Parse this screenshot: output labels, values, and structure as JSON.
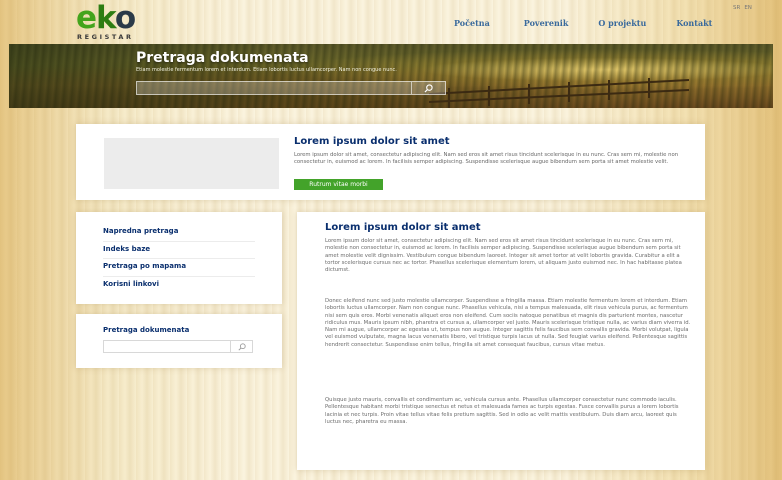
{
  "logo": {
    "word_e": "e",
    "word_k": "k",
    "word_o": "o",
    "subtitle": "REGISTAR",
    "colors": {
      "e": "#43a41c",
      "k": "#2d7d12",
      "o": "#2a3a48"
    }
  },
  "languages": [
    "SR",
    "EN"
  ],
  "nav": [
    "Početna",
    "Poverenik",
    "O projektu",
    "Kontakt"
  ],
  "banner": {
    "title": "Pretraga dokumenata",
    "text": "Etiam molestie fermentum lorem et interdum. Etiam lobortis luctus ullamcorper. Nam non congue nunc.",
    "search_value": "",
    "search_icon": "search-icon"
  },
  "featured": {
    "title": "Lorem ipsum dolor sit amet",
    "text": "Lorem ipsum dolor sit amet, consectetur adipiscing elit. Nam sed eros sit amet risus tincidunt scelerisque in eu nunc. Cras sem mi, molestie non consectetur in, euismod ac lorem. In facilisis semper adipiscing. Suspendisse scelerisque augue bibendum sem porta sit amet molestie velit.",
    "button": "Rutrum vitae morbi",
    "button_color": "#43a32a"
  },
  "sidebar": {
    "items": [
      "Napredna pretraga",
      "Indeks baze",
      "Pretraga po mapama",
      "Korisni linkovi"
    ],
    "search_title": "Pretraga dokumenata",
    "search_value": "",
    "search_icon": "search-icon"
  },
  "article": {
    "title": "Lorem ipsum dolor sit amet",
    "paragraphs": [
      "Lorem ipsum dolor sit amet, consectetur adipiscing elit. Nam sed eros sit amet risus tincidunt scelerisque in eu nunc. Cras sem mi, molestie non consectetur in, euismod ac lorem. In facilisis semper adipiscing. Suspendisse scelerisque augue bibendum sem porta sit amet molestie velit dignissim. Vestibulum congue bibendum laoreet. Integer sit amet tortor at velit lobortis gravida. Curabitur a elit a tortor scelerisque cursus nec ac tortor. Phasellus scelerisque elementum lorem, ut aliquam justo euismod nec. In hac habitasse platea dictumst.",
      "Donec eleifend nunc sed justo molestie ullamcorper. Suspendisse a fringilla massa. Etiam molestie fermentum lorem et interdum. Etiam lobortis luctus ullamcorper. Nam non congue nunc. Phasellus vehicula, nisi a tempus malesuada, elit risus vehicula purus, ac fermentum nisi sem quis eros. Morbi venenatis aliquet eros non eleifend. Cum sociis natoque penatibus et magnis dis parturient montes, nascetur ridiculus mus. Mauris ipsum nibh, pharetra et cursus a, ullamcorper vel justo. Mauris scelerisque tristique nulla, ac varius diam viverra id. Nam mi augue, ullamcorper ac egestas ut, tempus non augue. Integer sagittis felis faucibus sem convallis gravida. Morbi volutpat, ligula vel euismod vulputate, magna lacus venenatis libero, vel tristique turpis lacus ut nulla. Sed feugiat varius eleifend. Pellentesque sagittis hendrerit consectetur. Suspendisse enim tellus, fringilla sit amet consequat faucibus, cursus vitae metus.",
      "Quisque justo mauris, convallis et condimentum ac, vehicula cursus ante. Phasellus ullamcorper consectetur nunc commodo iaculis. Pellentesque habitant morbi tristique senectus et netus et malesuada fames ac turpis egestas. Fusce convallis purus a lorem lobortis lacinia et nec turpis. Proin vitae tellus vitae felis pretium sagittis. Sed in odio ac velit mattis vestibulum. Duis diam arcu, laoreet quis luctus nec, pharetra eu massa."
    ]
  }
}
